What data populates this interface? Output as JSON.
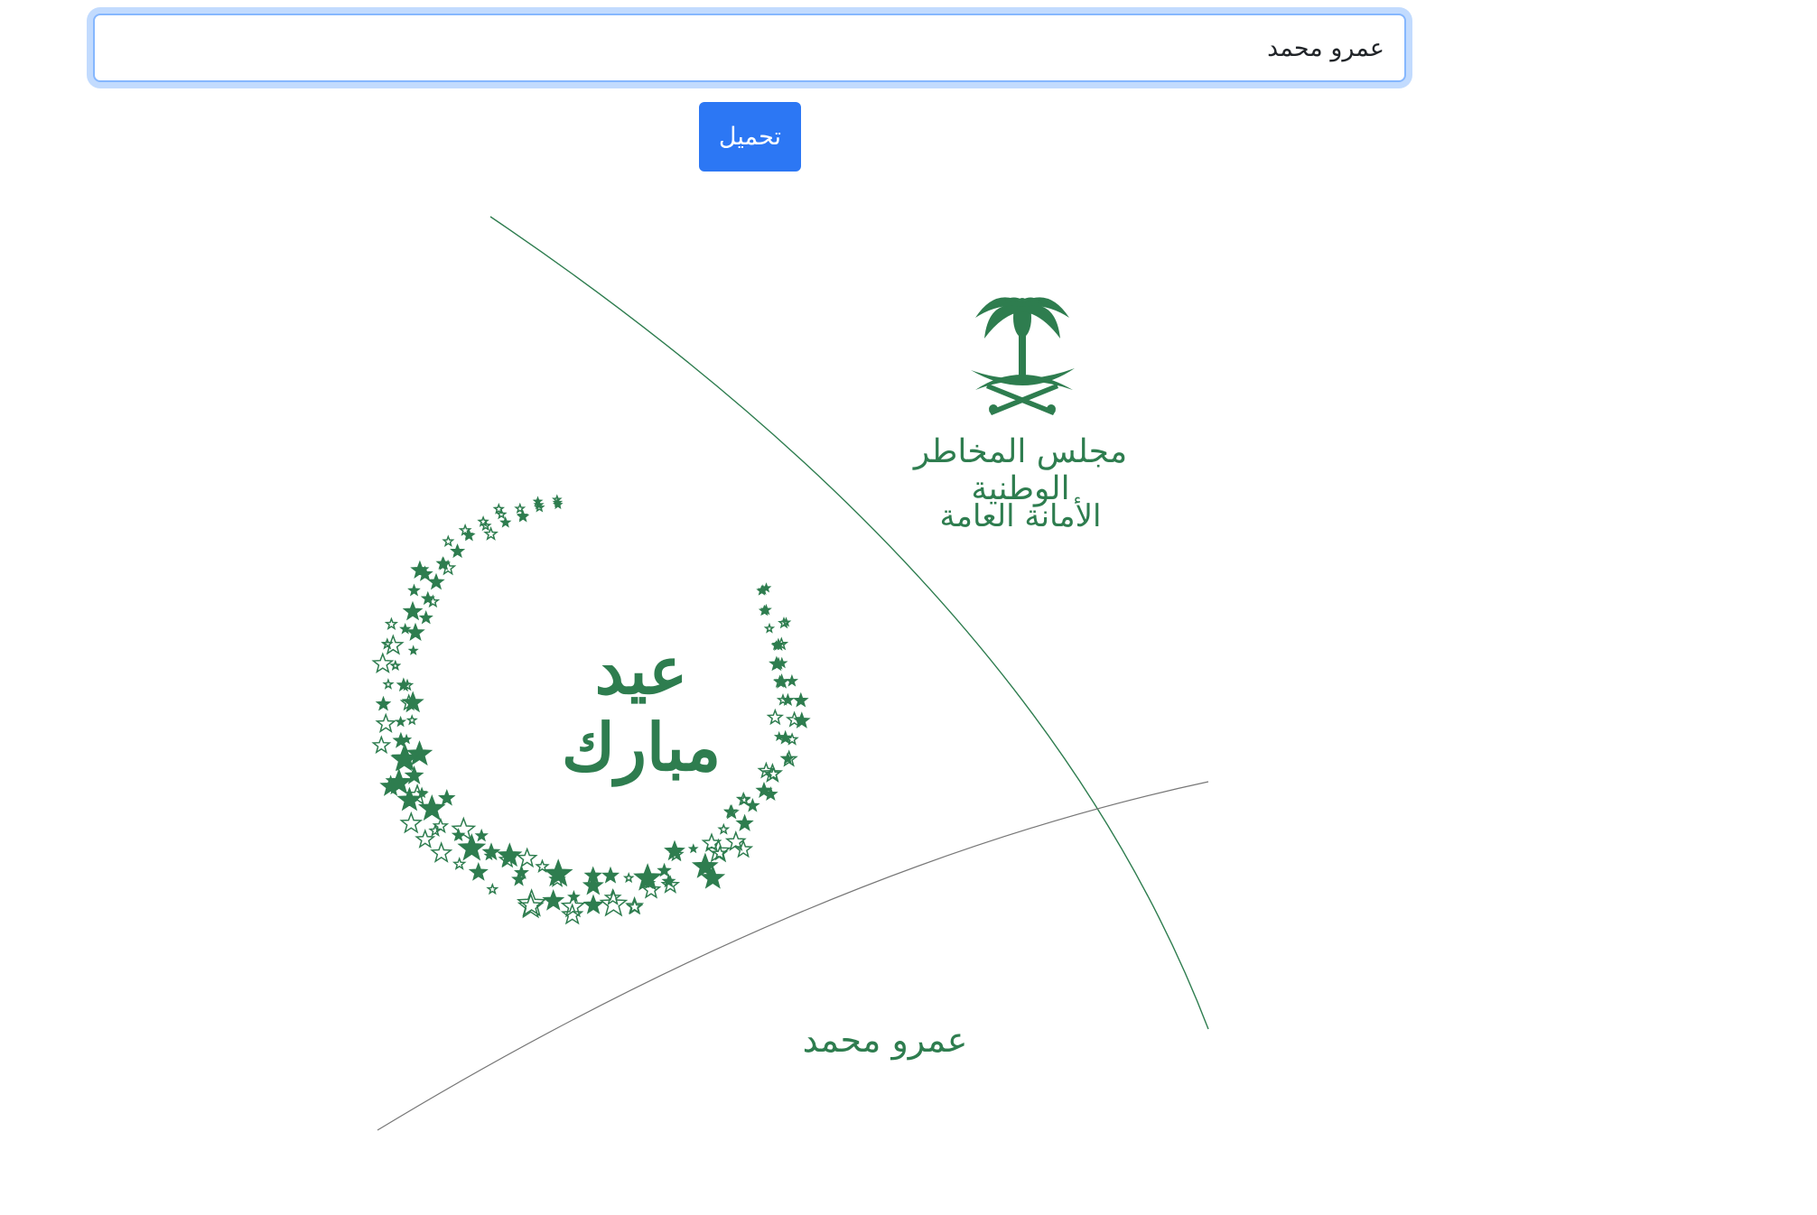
{
  "form": {
    "name_input_value": "عمرو محمد",
    "load_button_label": "تحميل"
  },
  "card": {
    "organization_name": "مجلس المخاطر الوطنية",
    "organization_department": "الأمانة العامة",
    "greeting": "عيد مبارك",
    "recipient_name": "عمرو محمد"
  },
  "colors": {
    "accent_green": "#2e7d4f",
    "button_blue": "#2c77f4",
    "focus_ring": "#86b7fe"
  }
}
